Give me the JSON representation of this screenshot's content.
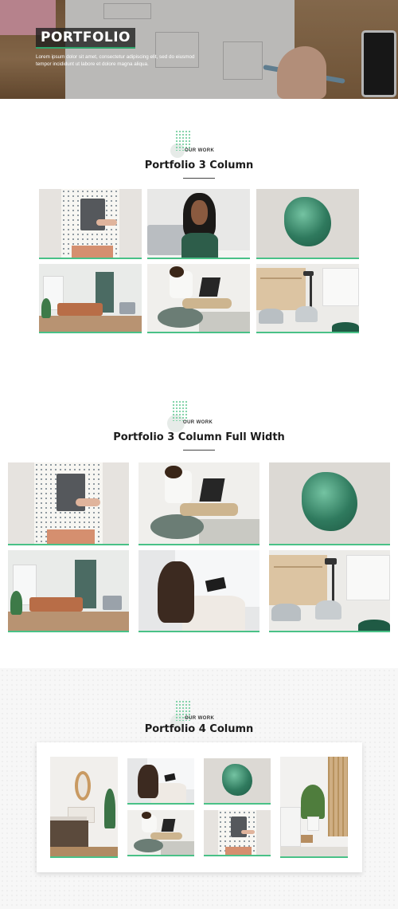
{
  "hero": {
    "title": "PORTFOLIO",
    "description": "Lorem ipsum dolor sit amet, consectetur adipiscing elit, sed do eiusmod tempor incididunt ut labore et dolore magna aliqua."
  },
  "sections": [
    {
      "eyebrow": "OUR WORK",
      "title": "Portfolio 3 Column"
    },
    {
      "eyebrow": "OUR WORK",
      "title": "Portfolio 3 Column Full Width"
    },
    {
      "eyebrow": "OUR WORK",
      "title": "Portfolio 4 Column"
    }
  ],
  "colors": {
    "accent": "#49c187",
    "dots": "#7fd2a6",
    "heading": "#1c1c1c"
  }
}
